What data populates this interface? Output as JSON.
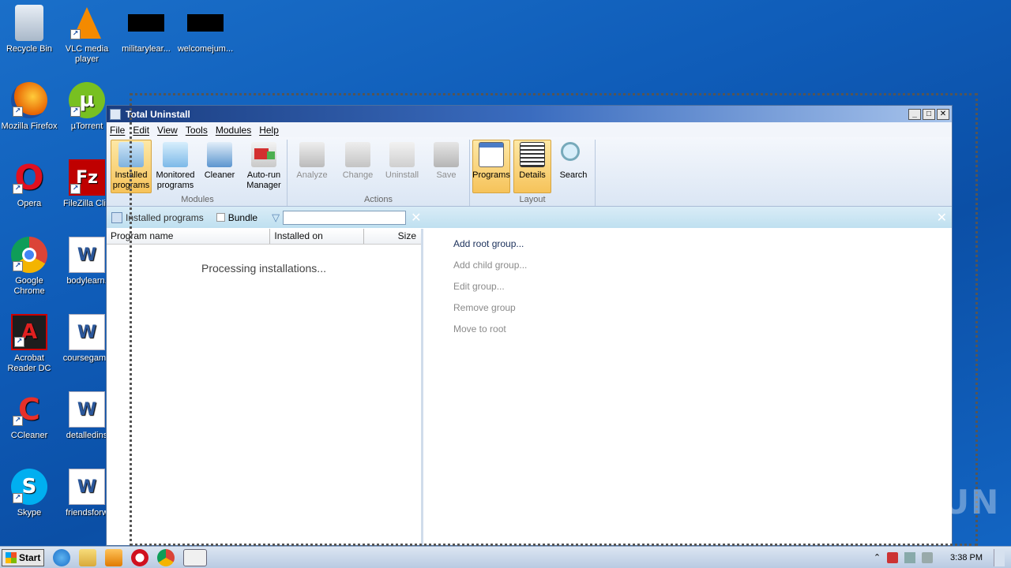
{
  "desktop": {
    "icons": [
      {
        "label": "Recycle Bin",
        "glyph": "🗑"
      },
      {
        "label": "VLC media player",
        "glyph": "▲"
      },
      {
        "label": "militarylear...",
        "glyph": ""
      },
      {
        "label": "welcomejum...",
        "glyph": ""
      },
      {
        "label": "Mozilla Firefox",
        "glyph": "●"
      },
      {
        "label": "µTorrent",
        "glyph": "µ"
      },
      {
        "label": "Opera",
        "glyph": "O"
      },
      {
        "label": "FileZilla Clie",
        "glyph": "Fz"
      },
      {
        "label": "Google Chrome",
        "glyph": "◉"
      },
      {
        "label": "bodylearn.",
        "glyph": "W"
      },
      {
        "label": "Acrobat Reader DC",
        "glyph": "A"
      },
      {
        "label": "coursegame",
        "glyph": "W"
      },
      {
        "label": "CCleaner",
        "glyph": "C"
      },
      {
        "label": "detalledins",
        "glyph": "W"
      },
      {
        "label": "Skype",
        "glyph": "S"
      },
      {
        "label": "friendsforw",
        "glyph": "W"
      }
    ]
  },
  "window": {
    "title": "Total Uninstall",
    "controls": {
      "minimize": "_",
      "maximize": "□",
      "close": "✕"
    },
    "menu": [
      "File",
      "Edit",
      "View",
      "Tools",
      "Modules",
      "Help"
    ],
    "ribbon": {
      "modules": {
        "label": "Modules",
        "buttons": [
          {
            "label": "Installed programs",
            "icon": "installed-programs-icon"
          },
          {
            "label": "Monitored programs",
            "icon": "monitored-programs-icon"
          },
          {
            "label": "Cleaner",
            "icon": "cleaner-icon"
          },
          {
            "label": "Auto-run Manager",
            "icon": "autorun-icon"
          }
        ]
      },
      "actions": {
        "label": "Actions",
        "buttons": [
          {
            "label": "Analyze",
            "icon": "analyze-icon"
          },
          {
            "label": "Change",
            "icon": "change-icon"
          },
          {
            "label": "Uninstall",
            "icon": "uninstall-icon"
          },
          {
            "label": "Save",
            "icon": "save-icon"
          }
        ]
      },
      "layout": {
        "label": "Layout",
        "buttons": [
          {
            "label": "Programs",
            "icon": "programs-layout-icon"
          },
          {
            "label": "Details",
            "icon": "details-layout-icon"
          },
          {
            "label": "Search",
            "icon": "search-icon"
          }
        ]
      }
    },
    "subbar": {
      "title": "Installed programs",
      "bundle_label": "Bundle",
      "filter_value": ""
    },
    "columns": [
      "Program name",
      "Installed on",
      "Size"
    ],
    "processing_text": "Processing installations...",
    "group_actions": [
      {
        "label": "Add root group...",
        "enabled": true
      },
      {
        "label": "Add child group...",
        "enabled": false
      },
      {
        "label": "Edit group...",
        "enabled": false
      },
      {
        "label": "Remove group",
        "enabled": false
      },
      {
        "label": "Move to root",
        "enabled": false
      }
    ]
  },
  "taskbar": {
    "start_label": "Start",
    "clock": "3:38 PM"
  },
  "watermark": "ANY RUN",
  "colors": {
    "desktop_bg": "#0f5cb8",
    "active_button": "#f6c35a",
    "titlebar": "#1a3d80"
  }
}
